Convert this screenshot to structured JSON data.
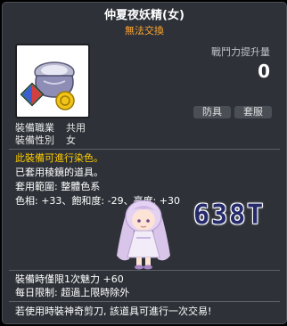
{
  "item": {
    "name": "仲夏夜妖精(女)",
    "trade_status": "無法交換",
    "icon": "clothing-bundle-icon"
  },
  "power": {
    "label": "戰鬥力提升量",
    "value": "0"
  },
  "tags": {
    "armor": "防具",
    "slot": "套服"
  },
  "stats": [
    {
      "label": "裝備職業",
      "value": "共用"
    },
    {
      "label": "裝備性別",
      "value": "女"
    }
  ],
  "dye": {
    "notice": "此裝備可進行染色。",
    "applied": "已套用稜鏡的道具。",
    "range": "套用範圍: 整體色系",
    "values": "色相: +33、飽和度: -29、亮度: +30"
  },
  "overlay_text": "638T",
  "bonus": {
    "charm": "裝備時僅限1次魅力 +60",
    "limit": "每日限制: 超過上限時除外"
  },
  "footer": "若使用時裝神奇剪刀, 該道具可進行一次交易!",
  "colors": {
    "background": "#2e3238",
    "trade_status": "#ffa531",
    "dye_notice": "#ffcc00",
    "overlay_text": "#252a6b"
  }
}
